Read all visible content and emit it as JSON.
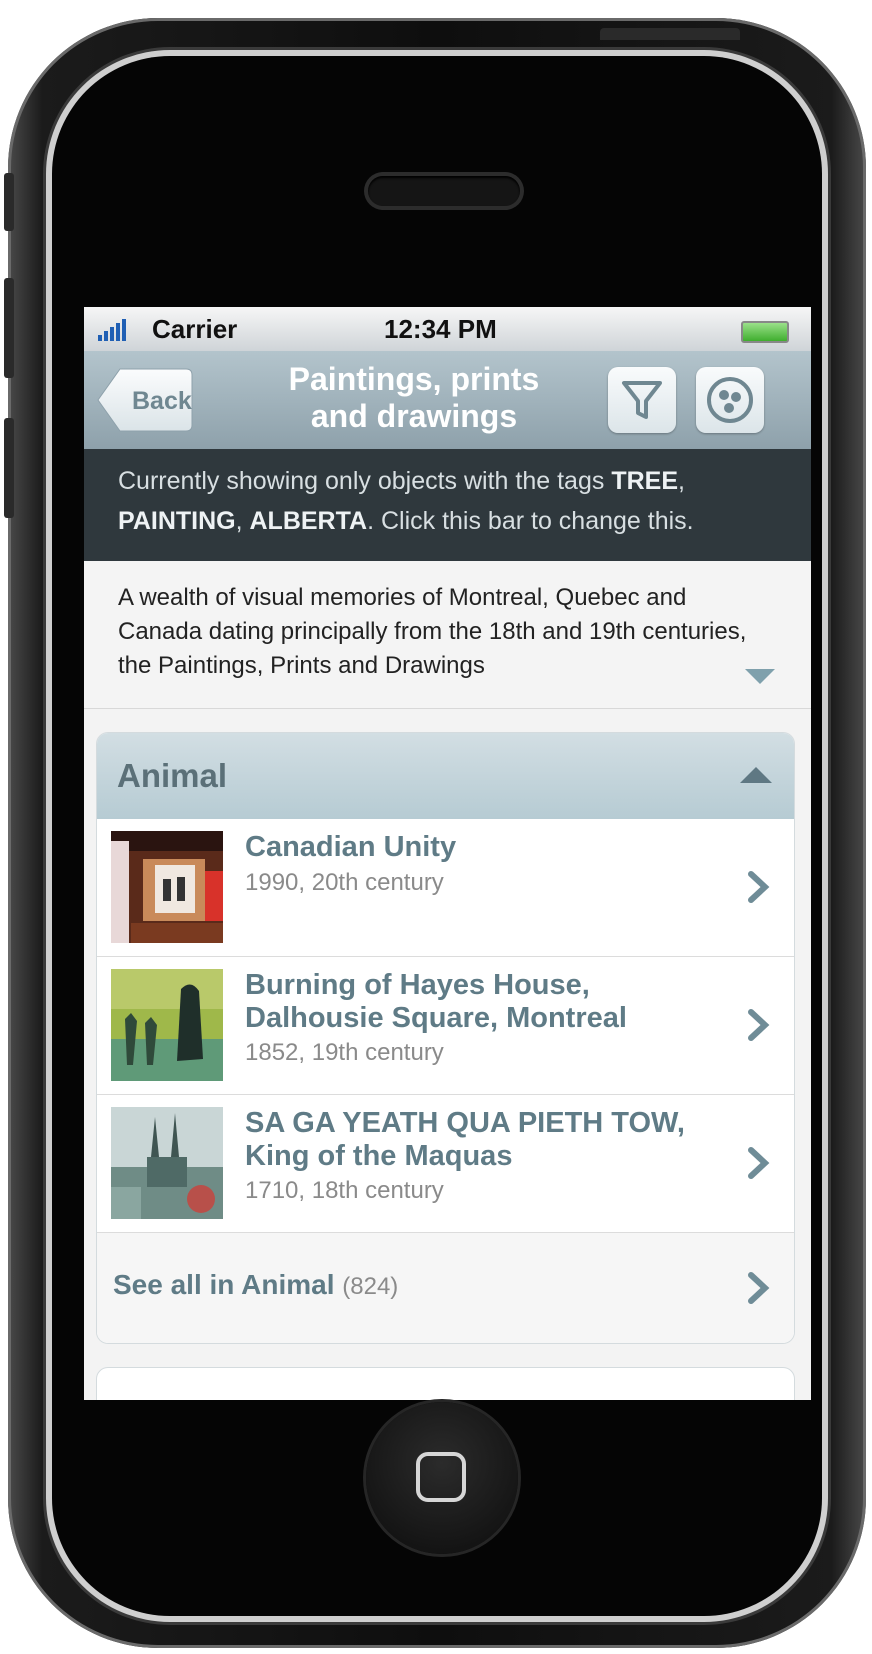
{
  "status_bar": {
    "carrier": "Carrier",
    "time": "12:34 PM"
  },
  "nav": {
    "back_label": "Back",
    "title_line1": "Paintings, prints",
    "title_line2": "and drawings",
    "filter_icon": "filter-icon",
    "share_icon": "circle-dots-icon"
  },
  "filter_bar": {
    "prefix": "Currently showing only objects with the tags ",
    "tag1": "TREE",
    "sep1": ",",
    "tag2": "PAINTING",
    "sep2": ", ",
    "tag3": "ALBERTA",
    "suffix": ". Click this bar to change this."
  },
  "description": "A wealth of visual memories of Montreal, Quebec and Canada dating principally from the 18th and 19th centuries, the Paintings, Prints and Drawings",
  "section": {
    "title": "Animal",
    "items": [
      {
        "title": "Canadian Unity",
        "subtitle": "1990, 20th century"
      },
      {
        "title": "Burning of Hayes House, Dalhousie Square, Montreal",
        "subtitle": "1852, 19th century"
      },
      {
        "title": "SA GA YEATH QUA PIETH TOW, King of the Maquas",
        "subtitle": "1710, 18th century"
      }
    ],
    "see_all_label": "See all in Animal",
    "see_all_count": "(824)"
  },
  "colors": {
    "accent": "#5f7b86",
    "nav_bg": "#9fb2bb",
    "filter_bg": "#2f383d"
  }
}
